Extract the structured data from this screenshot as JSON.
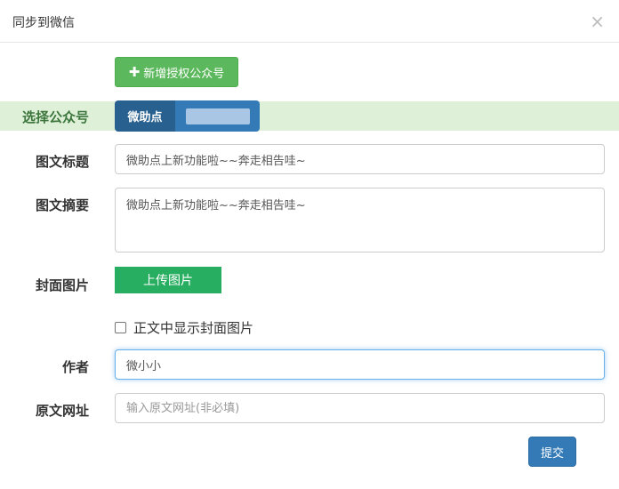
{
  "modal": {
    "title": "同步到微信",
    "close": "×"
  },
  "add_button": {
    "icon": "plus-icon",
    "plus": "✚",
    "label": "新增授权公众号",
    "color": "#5cb85c"
  },
  "account": {
    "label": "选择公众号",
    "selected": "微助点",
    "highlight_color": "#dff0d8"
  },
  "form": {
    "title": {
      "label": "图文标题",
      "value": "微助点上新功能啦~~奔走相告哇~"
    },
    "summary": {
      "label": "图文摘要",
      "value": "微助点上新功能啦~~奔走相告哇~"
    },
    "cover": {
      "label": "封面图片",
      "upload_label": "上传图片",
      "show_in_body_label": "正文中显示封面图片",
      "show_in_body_checked": false
    },
    "author": {
      "label": "作者",
      "value": "微小小"
    },
    "source_url": {
      "label": "原文网址",
      "placeholder": "输入原文网址(非必填)"
    }
  },
  "submit": {
    "label": "提交",
    "color": "#337ab7"
  }
}
